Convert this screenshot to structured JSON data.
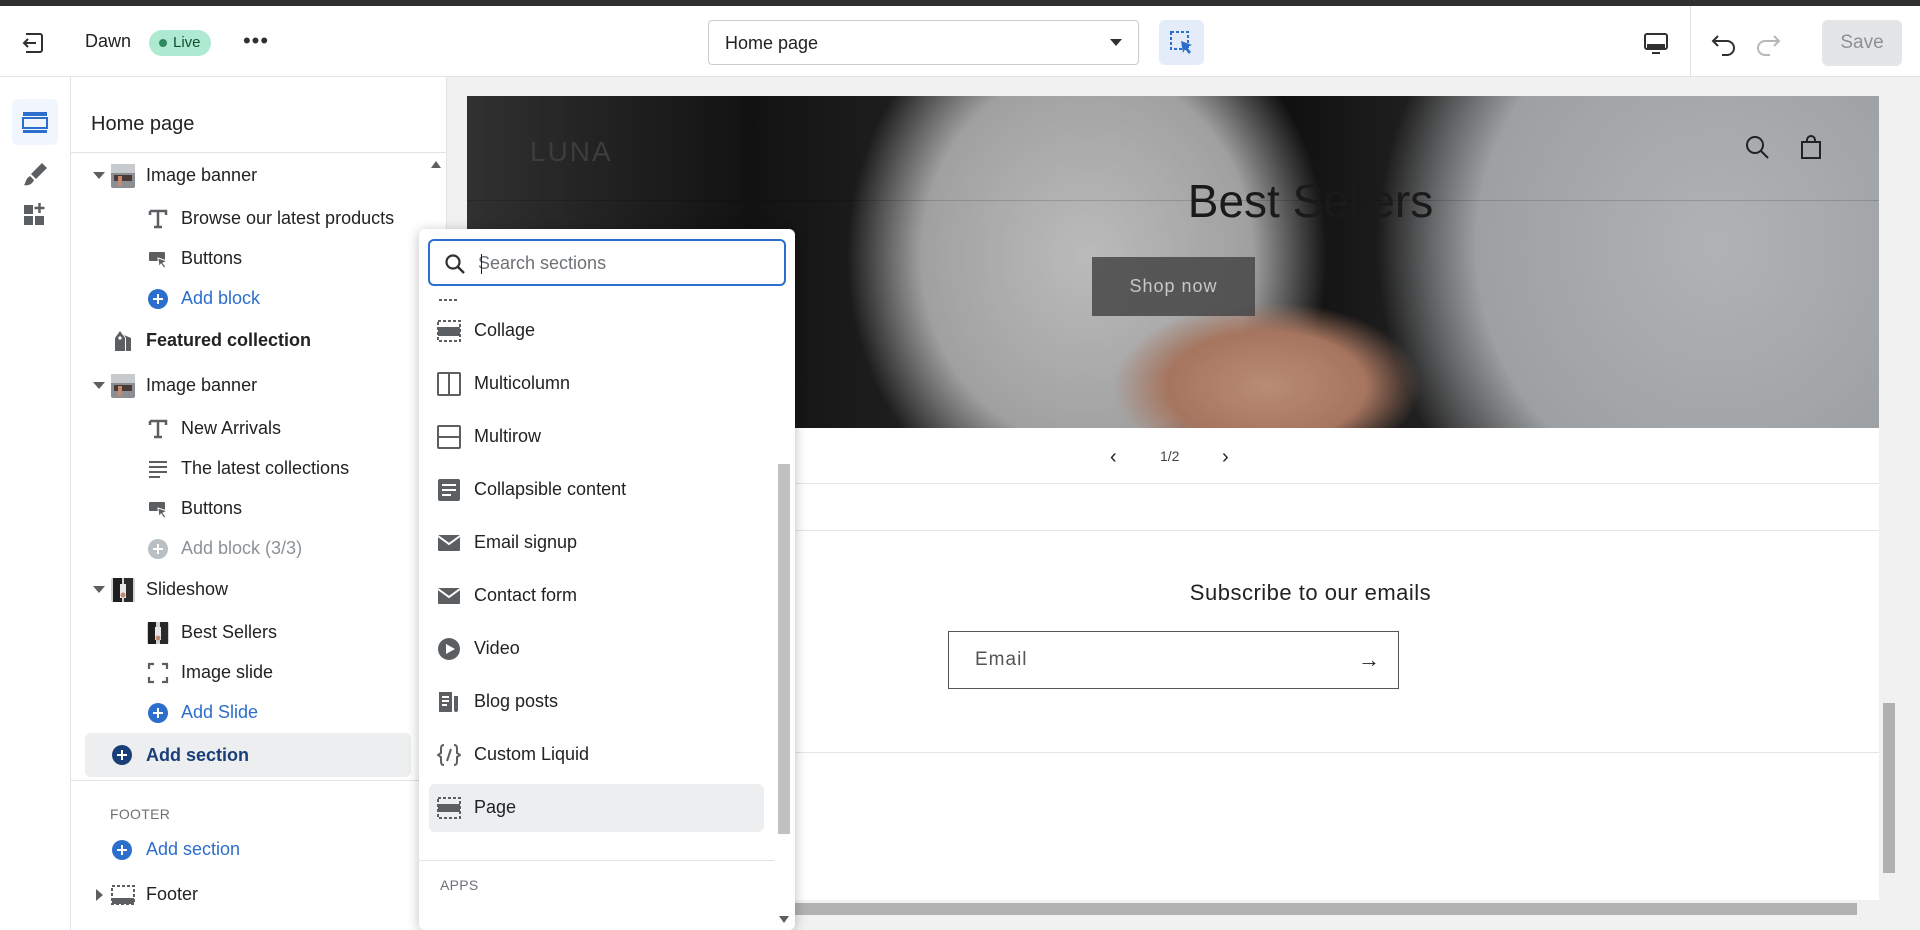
{
  "topbar": {
    "theme_name": "Dawn",
    "live_badge": "Live",
    "page_select": "Home page",
    "save_label": "Save"
  },
  "sidebar": {
    "title": "Home page",
    "tree": [
      {
        "label": "Image banner",
        "kind": "section"
      },
      {
        "label": "Browse our latest products",
        "kind": "block"
      },
      {
        "label": "Buttons",
        "kind": "block"
      },
      {
        "label": "Add block",
        "kind": "add"
      },
      {
        "label": "Featured collection",
        "kind": "section-bold"
      },
      {
        "label": "Image banner",
        "kind": "section"
      },
      {
        "label": "New Arrivals",
        "kind": "block"
      },
      {
        "label": "The latest collections",
        "kind": "block"
      },
      {
        "label": "Buttons",
        "kind": "block"
      },
      {
        "label": "Add block (3/3)",
        "kind": "add-disabled"
      },
      {
        "label": "Slideshow",
        "kind": "section"
      },
      {
        "label": "Best Sellers",
        "kind": "block"
      },
      {
        "label": "Image slide",
        "kind": "block"
      },
      {
        "label": "Add Slide",
        "kind": "add"
      }
    ],
    "add_section": "Add section",
    "footer_heading": "FOOTER",
    "footer_add_section": "Add section",
    "footer_item": "Footer"
  },
  "preview": {
    "store_logo": "LUNA",
    "hero_title": "Best Sellers",
    "shop_button": "Shop now",
    "slide_prev": "‹",
    "slide_counter": "1/2",
    "slide_next": "›",
    "newsletter_title": "Subscribe to our emails",
    "email_placeholder": "Email",
    "email_arrow": "→"
  },
  "popover": {
    "search_placeholder": "Search sections",
    "items": [
      {
        "label": "Collage",
        "icon": "collage-icon"
      },
      {
        "label": "Multicolumn",
        "icon": "multicolumn-icon"
      },
      {
        "label": "Multirow",
        "icon": "multirow-icon"
      },
      {
        "label": "Collapsible content",
        "icon": "collapsible-icon"
      },
      {
        "label": "Email signup",
        "icon": "email-icon"
      },
      {
        "label": "Contact form",
        "icon": "contact-form-icon"
      },
      {
        "label": "Video",
        "icon": "video-icon"
      },
      {
        "label": "Blog posts",
        "icon": "blog-icon"
      },
      {
        "label": "Custom Liquid",
        "icon": "code-icon"
      },
      {
        "label": "Page",
        "icon": "page-icon"
      }
    ],
    "apps_heading": "APPS"
  },
  "colors": {
    "accent": "#2c6ecb",
    "live_badge_bg": "#aee9d1",
    "active_bg": "#edeeef"
  }
}
